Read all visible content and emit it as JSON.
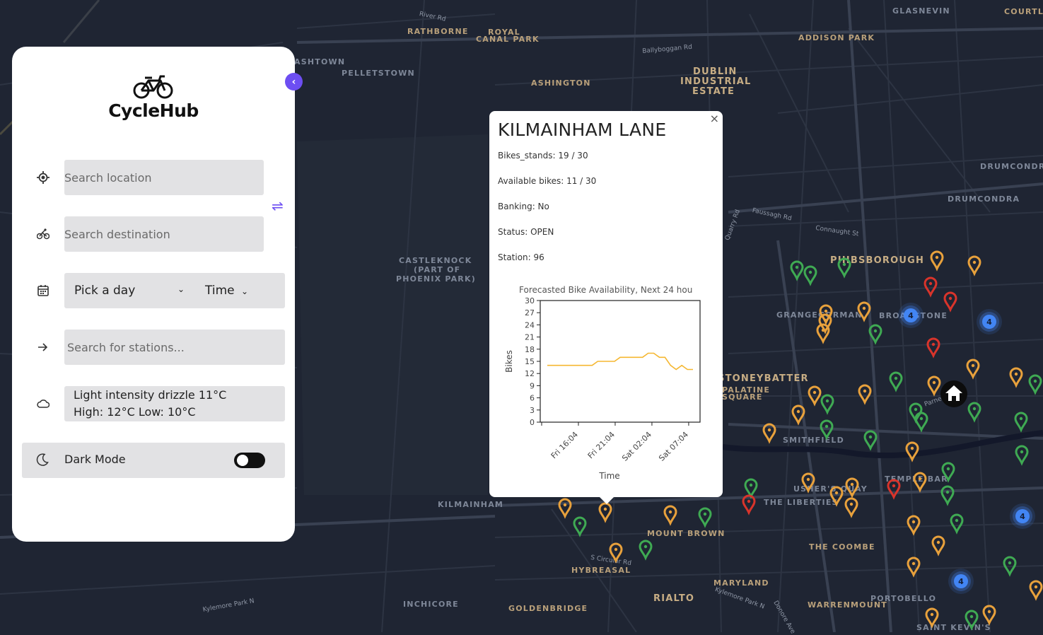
{
  "map": {
    "area_labels": [
      {
        "text": "GLASNEVIN",
        "cls": "faint"
      },
      {
        "text": "COURTLA",
        "cls": ""
      },
      {
        "text": "RATHBORNE",
        "cls": ""
      },
      {
        "text": "ROYAL",
        "cls": ""
      },
      {
        "text": "CANAL PARK",
        "cls": ""
      },
      {
        "text": "ADDISON PARK",
        "cls": ""
      },
      {
        "text": "ASHTOWN",
        "cls": "faint"
      },
      {
        "text": "PELLETSTOWN",
        "cls": "faint"
      },
      {
        "text": "ASHINGTON",
        "cls": ""
      },
      {
        "text": "DUBLIN",
        "cls": "big"
      },
      {
        "text": "INDUSTRIAL",
        "cls": "big"
      },
      {
        "text": "ESTATE",
        "cls": "big"
      },
      {
        "text": "DRUMCONDR",
        "cls": "faint"
      },
      {
        "text": "DRUMCONDRA",
        "cls": "faint"
      },
      {
        "text": "PHIBSBOROUGH",
        "cls": "big"
      },
      {
        "text": "CASTLEKNOCK",
        "cls": "faint"
      },
      {
        "text": "(PART OF",
        "cls": "faint"
      },
      {
        "text": "PHOENIX PARK)",
        "cls": "faint"
      },
      {
        "text": "GRANGEGORMAN",
        "cls": "faint"
      },
      {
        "text": "BROADSTONE",
        "cls": "faint"
      },
      {
        "text": "STONEYBATTER",
        "cls": "big"
      },
      {
        "text": "PALATINE",
        "cls": ""
      },
      {
        "text": "SQUARE",
        "cls": ""
      },
      {
        "text": "SMITHFIELD",
        "cls": "faint"
      },
      {
        "text": "TEMPLE BAR",
        "cls": "faint"
      },
      {
        "text": "USHER'S QUAY",
        "cls": "faint"
      },
      {
        "text": "THE LIBERTIES",
        "cls": "faint"
      },
      {
        "text": "KILMAINHAM",
        "cls": "faint"
      },
      {
        "text": "MOUNT BROWN",
        "cls": ""
      },
      {
        "text": "THE COOMBE",
        "cls": ""
      },
      {
        "text": "HYBREASAL",
        "cls": ""
      },
      {
        "text": "MARYLAND",
        "cls": ""
      },
      {
        "text": "RIALTO",
        "cls": "big"
      },
      {
        "text": "INCHICORE",
        "cls": "faint"
      },
      {
        "text": "GOLDENBRIDGE",
        "cls": ""
      },
      {
        "text": "WARRENMOUNT",
        "cls": ""
      },
      {
        "text": "PORTOBELLO",
        "cls": "faint"
      },
      {
        "text": "SAINT KEVIN'S",
        "cls": "faint"
      }
    ],
    "street_labels": [
      "River Rd",
      "Ballyboggan Rd",
      "Faussagh Rd",
      "Connaught St",
      "Quarry Rd",
      "S Circular Rd",
      "Kylemore Park N",
      "Donore Ave",
      "Parnell"
    ],
    "cluster_count": "4",
    "colors": {
      "orange": "#e8a13c",
      "green": "#3faa53",
      "red": "#d9342b",
      "blue": "#4285f4"
    }
  },
  "sidebar": {
    "collapse_icon": "chevron-left-icon",
    "app_name": "CycleHub",
    "search_location_placeholder": "Search location",
    "search_destination_placeholder": "Search destination",
    "day_label": "Pick a day",
    "time_label": "Time",
    "stations_placeholder": "Search for stations...",
    "weather_line1": "Light intensity drizzle 11°C",
    "weather_line2": "High: 12°C Low: 10°C",
    "dark_mode_label": "Dark Mode",
    "dark_mode_on": false
  },
  "popup": {
    "title": "KILMAINHAM LANE",
    "bikes_stands": "Bikes_stands: 19 / 30",
    "available_bikes": "Available bikes: 11 / 30",
    "banking": "Banking: No",
    "status": "Status: OPEN",
    "station": "Station: 96",
    "close_label": "×"
  },
  "chart_data": {
    "type": "line",
    "title": "Forecasted Bike Availability, Next 24 hou",
    "xlabel": "Time",
    "ylabel": "Bikes",
    "ylim": [
      0,
      30
    ],
    "yticks": [
      0,
      3,
      6,
      9,
      12,
      15,
      18,
      21,
      24,
      27,
      30
    ],
    "xticks": [
      "Fri 16:04",
      "Fri 21:04",
      "Sat 02:04",
      "Sat 07:04"
    ],
    "grid": false,
    "series": [
      {
        "color": "#f5b731",
        "values": [
          14,
          14,
          14,
          14,
          14,
          14,
          14,
          14,
          14,
          15,
          15,
          15,
          15,
          16,
          16,
          16,
          16,
          16,
          17,
          17,
          16,
          16,
          14,
          13,
          14,
          13,
          13
        ]
      }
    ]
  }
}
